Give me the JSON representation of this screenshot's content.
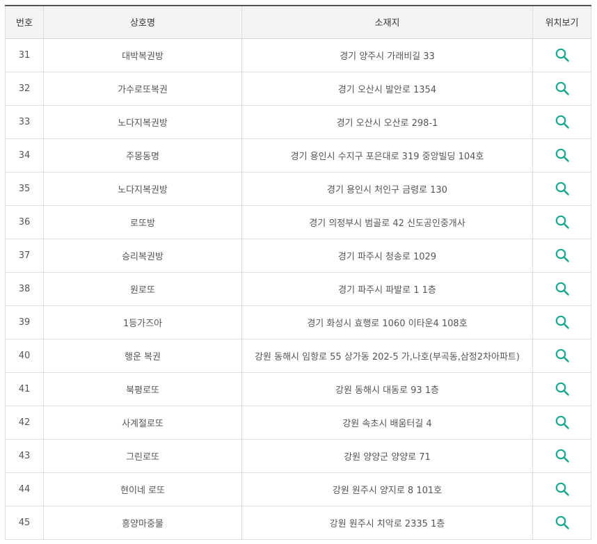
{
  "table": {
    "headers": {
      "no": "번호",
      "name": "상호명",
      "address": "소재지",
      "location": "위치보기"
    },
    "icon": "search-icon",
    "icon_color": "#1aa58f",
    "rows": [
      {
        "no": "31",
        "name": "대박복권방",
        "address": "경기 양주시 가래비길 33"
      },
      {
        "no": "32",
        "name": "가수로또복권",
        "address": "경기 오산시 발안로 1354"
      },
      {
        "no": "33",
        "name": "노다지복권방",
        "address": "경기 오산시 오산로 298-1"
      },
      {
        "no": "34",
        "name": "주몽동명",
        "address": "경기 용인시 수지구 포은대로 319 중앙빌딩 104호"
      },
      {
        "no": "35",
        "name": "노다지복권방",
        "address": "경기 용인시 처인구 금령로 130"
      },
      {
        "no": "36",
        "name": "로또방",
        "address": "경기 의정부시 범골로 42 신도공인중개사"
      },
      {
        "no": "37",
        "name": "승리복권방",
        "address": "경기 파주시 청송로 1029"
      },
      {
        "no": "38",
        "name": "원로또",
        "address": "경기 파주시 파발로 1 1층"
      },
      {
        "no": "39",
        "name": "1등가즈아",
        "address": "경기 화성시 효행로 1060 이타운4 108호"
      },
      {
        "no": "40",
        "name": "행운 복권",
        "address": "강원 동해시 임항로 55 상가동 202-5 가,나호(부곡동,삼정2차아파트)"
      },
      {
        "no": "41",
        "name": "북평로또",
        "address": "강원 동해시 대동로 93 1층"
      },
      {
        "no": "42",
        "name": "사계절로또",
        "address": "강원 속초시 배움터길 4"
      },
      {
        "no": "43",
        "name": "그린로또",
        "address": "강원 양양군 양양로 71"
      },
      {
        "no": "44",
        "name": "현이네 로또",
        "address": "강원 원주시 양지로 8 101호"
      },
      {
        "no": "45",
        "name": "흥양마중물",
        "address": "강원 원주시 치악로 2335 1층"
      }
    ]
  }
}
